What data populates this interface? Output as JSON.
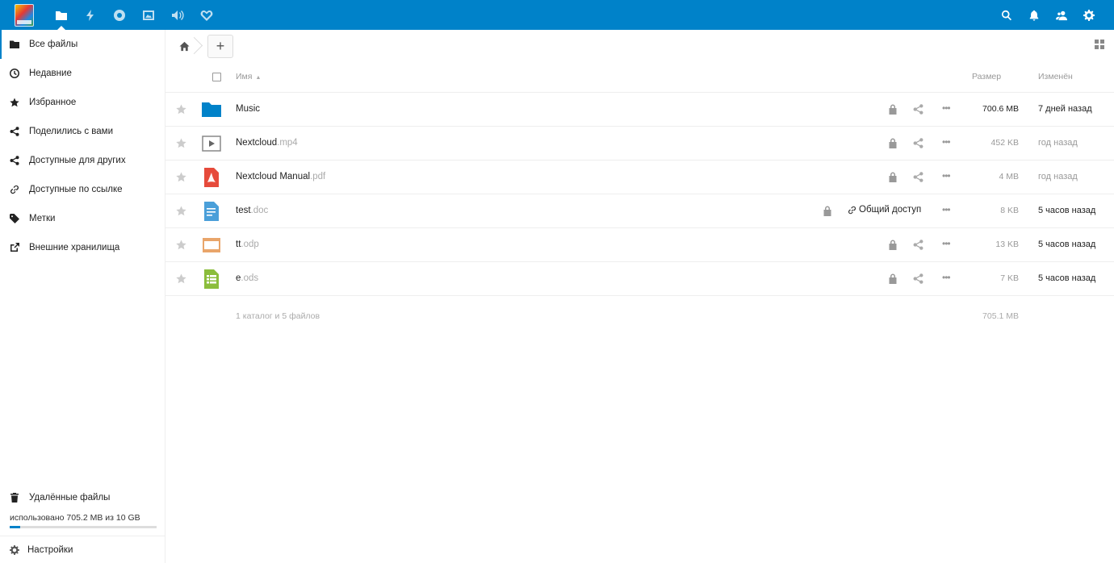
{
  "header": {
    "apps": [
      {
        "name": "files-app-icon",
        "active": true
      },
      {
        "name": "activity-app-icon",
        "active": false
      },
      {
        "name": "gallery-app-icon",
        "active": false
      },
      {
        "name": "pictures-app-icon",
        "active": false
      },
      {
        "name": "audio-player-app-icon",
        "active": false
      },
      {
        "name": "deck-app-icon",
        "active": false
      }
    ],
    "right_icons": [
      "search-icon",
      "notifications-icon",
      "contacts-icon",
      "settings-icon"
    ]
  },
  "sidebar": {
    "items": [
      {
        "label": "Все файлы",
        "icon": "folder-icon",
        "active": true
      },
      {
        "label": "Недавние",
        "icon": "clock-icon",
        "active": false
      },
      {
        "label": "Избранное",
        "icon": "star-icon",
        "active": false
      },
      {
        "label": "Поделились с вами",
        "icon": "share-icon",
        "active": false
      },
      {
        "label": "Доступные для других",
        "icon": "share-icon",
        "active": false
      },
      {
        "label": "Доступные по ссылке",
        "icon": "link-icon",
        "active": false
      },
      {
        "label": "Метки",
        "icon": "tag-icon",
        "active": false
      },
      {
        "label": "Внешние хранилища",
        "icon": "external-icon",
        "active": false
      }
    ],
    "trash_label": "Удалённые файлы",
    "quota_text": "использовано 705.2 MB из 10 GB",
    "quota_fraction": 0.07,
    "settings_label": "Настройки"
  },
  "toolbar": {
    "add_label": "+"
  },
  "table": {
    "header_name": "Имя",
    "header_size": "Размер",
    "header_modified": "Изменён",
    "rows": [
      {
        "base": "Music",
        "ext": "",
        "type": "folder",
        "size": "700.6 MB",
        "size_color": "#222",
        "modified": "7 дней назад",
        "mod_color": "#222",
        "shared": false
      },
      {
        "base": "Nextcloud",
        "ext": ".mp4",
        "type": "video",
        "size": "452 KB",
        "size_color": "#999",
        "modified": "год назад",
        "mod_color": "#999",
        "shared": false
      },
      {
        "base": "Nextcloud Manual",
        "ext": ".pdf",
        "type": "pdf",
        "size": "4 MB",
        "size_color": "#999",
        "modified": "год назад",
        "mod_color": "#999",
        "shared": false
      },
      {
        "base": "test",
        "ext": ".doc",
        "type": "doc",
        "size": "8 KB",
        "size_color": "#999",
        "modified": "5 часов назад",
        "mod_color": "#222",
        "shared": true,
        "shared_label": "Общий доступ"
      },
      {
        "base": "tt",
        "ext": ".odp",
        "type": "presentation",
        "size": "13 KB",
        "size_color": "#999",
        "modified": "5 часов назад",
        "mod_color": "#222",
        "shared": false
      },
      {
        "base": "e",
        "ext": ".ods",
        "type": "spreadsheet",
        "size": "7 KB",
        "size_color": "#999",
        "modified": "5 часов назад",
        "mod_color": "#222",
        "shared": false
      }
    ],
    "summary_text": "1 каталог и 5 файлов",
    "summary_size": "705.1 MB"
  },
  "colors": {
    "accent": "#0082c9",
    "folder": "#0082c9",
    "pdf": "#e64a3b",
    "doc": "#4a9fd9",
    "presentation": "#e9a56a",
    "spreadsheet": "#8bbd3c"
  }
}
